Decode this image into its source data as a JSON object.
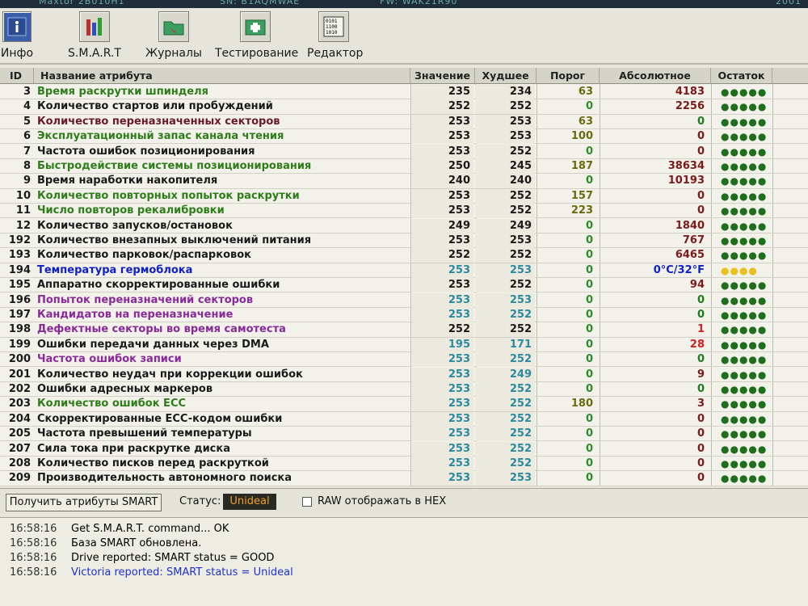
{
  "top_strip": {
    "model": "Maxtor 2B010H1",
    "serial": "SN: B1AQMWAE",
    "firmware": "FW: WAK21R90",
    "right": "2001"
  },
  "toolbar": [
    {
      "name": "info",
      "label": "Инфо"
    },
    {
      "name": "smart",
      "label": "S.M.A.R.T"
    },
    {
      "name": "journals",
      "label": "Журналы"
    },
    {
      "name": "testing",
      "label": "Тестирование"
    },
    {
      "name": "editor",
      "label": "Редактор"
    }
  ],
  "table": {
    "headers": {
      "id": "ID",
      "name": "Название атрибута",
      "value": "Значение",
      "worst": "Худшее",
      "threshold": "Порог",
      "raw": "Абсолютное",
      "remaining": "Остаток"
    },
    "rows": [
      {
        "id": "3",
        "name": "Время раскрутки шпинделя",
        "value": "235",
        "worst": "234",
        "threshold": "63",
        "raw": "4183",
        "rem": "●●●●●"
      },
      {
        "id": "4",
        "name": "Количество стартов или пробуждений",
        "value": "252",
        "worst": "252",
        "threshold": "0",
        "raw": "2256",
        "rem": "●●●●●"
      },
      {
        "id": "5",
        "name": "Количество переназначенных секторов",
        "value": "253",
        "worst": "253",
        "threshold": "63",
        "raw": "0",
        "rem": "●●●●●"
      },
      {
        "id": "6",
        "name": "Эксплуатационный запас канала чтения",
        "value": "253",
        "worst": "253",
        "threshold": "100",
        "raw": "0",
        "rem": "●●●●●"
      },
      {
        "id": "7",
        "name": "Частота ошибок позиционирования",
        "value": "253",
        "worst": "252",
        "threshold": "0",
        "raw": "0",
        "rem": "●●●●●"
      },
      {
        "id": "8",
        "name": "Быстродействие системы позиционирования",
        "value": "250",
        "worst": "245",
        "threshold": "187",
        "raw": "38634",
        "rem": "●●●●●"
      },
      {
        "id": "9",
        "name": "Время наработки накопителя",
        "value": "240",
        "worst": "240",
        "threshold": "0",
        "raw": "10193",
        "rem": "●●●●●"
      },
      {
        "id": "10",
        "name": "Количество повторных попыток раскрутки",
        "value": "253",
        "worst": "252",
        "threshold": "157",
        "raw": "0",
        "rem": "●●●●●"
      },
      {
        "id": "11",
        "name": "Число повторов рекалибровки",
        "value": "253",
        "worst": "252",
        "threshold": "223",
        "raw": "0",
        "rem": "●●●●●"
      },
      {
        "id": "12",
        "name": "Количество запусков/остановок",
        "value": "249",
        "worst": "249",
        "threshold": "0",
        "raw": "1840",
        "rem": "●●●●●"
      },
      {
        "id": "192",
        "name": "Количество внезапных выключений питания",
        "value": "253",
        "worst": "253",
        "threshold": "0",
        "raw": "767",
        "rem": "●●●●●"
      },
      {
        "id": "193",
        "name": "Количество парковок/распарковок",
        "value": "252",
        "worst": "252",
        "threshold": "0",
        "raw": "6465",
        "rem": "●●●●●"
      },
      {
        "id": "194",
        "name": "Температура гермоблока",
        "value": "253",
        "worst": "253",
        "threshold": "0",
        "raw": "0°C/32°F",
        "rem": "●●●●"
      },
      {
        "id": "195",
        "name": "Аппаратно скорректированные ошибки",
        "value": "253",
        "worst": "252",
        "threshold": "0",
        "raw": "94",
        "rem": "●●●●●"
      },
      {
        "id": "196",
        "name": "Попыток переназначений секторов",
        "value": "253",
        "worst": "253",
        "threshold": "0",
        "raw": "0",
        "rem": "●●●●●"
      },
      {
        "id": "197",
        "name": "Кандидатов на переназначение",
        "value": "253",
        "worst": "252",
        "threshold": "0",
        "raw": "0",
        "rem": "●●●●●"
      },
      {
        "id": "198",
        "name": "Дефектные секторы во время самотеста",
        "value": "252",
        "worst": "252",
        "threshold": "0",
        "raw": "1",
        "rem": "●●●●●"
      },
      {
        "id": "199",
        "name": "Ошибки передачи данных через DMA",
        "value": "195",
        "worst": "171",
        "threshold": "0",
        "raw": "28",
        "rem": "●●●●●"
      },
      {
        "id": "200",
        "name": "Частота ошибок записи",
        "value": "253",
        "worst": "252",
        "threshold": "0",
        "raw": "0",
        "rem": "●●●●●"
      },
      {
        "id": "201",
        "name": "Количество неудач при коррекции ошибок",
        "value": "253",
        "worst": "249",
        "threshold": "0",
        "raw": "9",
        "rem": "●●●●●"
      },
      {
        "id": "202",
        "name": "Ошибки адресных маркеров",
        "value": "253",
        "worst": "252",
        "threshold": "0",
        "raw": "0",
        "rem": "●●●●●"
      },
      {
        "id": "203",
        "name": "Количество ошибок ECC",
        "value": "253",
        "worst": "252",
        "threshold": "180",
        "raw": "3",
        "rem": "●●●●●"
      },
      {
        "id": "204",
        "name": "Скорректированные ECC-кодом ошибки",
        "value": "253",
        "worst": "252",
        "threshold": "0",
        "raw": "0",
        "rem": "●●●●●"
      },
      {
        "id": "205",
        "name": "Частота превышений температуры",
        "value": "253",
        "worst": "252",
        "threshold": "0",
        "raw": "0",
        "rem": "●●●●●"
      },
      {
        "id": "207",
        "name": "Сила тока при раскрутке диска",
        "value": "253",
        "worst": "252",
        "threshold": "0",
        "raw": "0",
        "rem": "●●●●●"
      },
      {
        "id": "208",
        "name": "Количество писков перед раскруткой",
        "value": "253",
        "worst": "252",
        "threshold": "0",
        "raw": "0",
        "rem": "●●●●●"
      },
      {
        "id": "209",
        "name": "Производительность автономного поиска",
        "value": "253",
        "worst": "253",
        "threshold": "0",
        "raw": "0",
        "rem": "●●●●●"
      }
    ]
  },
  "colors": {
    "name_green": "#2e7d1a",
    "name_dark": "#1a1a1a",
    "name_maroon": "#6a1830",
    "name_purple": "#8a2a9a",
    "name_blue": "#1020c8",
    "val_dark": "#1a1a1a",
    "val_teal": "#2a8aa0",
    "thr_olive": "#6a6a10",
    "thr_green": "#2e8a2e",
    "raw_maroon": "#7a1a1a",
    "raw_green": "#1e7a1e",
    "raw_red": "#d02020",
    "raw_blue": "#1020c8",
    "dots_green": "#1e6e1e",
    "dots_yellow": "#e8c020",
    "log_blue": "#2030d0"
  },
  "controls": {
    "get_button": "Получить атрибуты SMART",
    "status_label": "Статус:",
    "status_value": "Unideal",
    "raw_hex_label": "RAW отображать в HEX"
  },
  "log": [
    {
      "time": "16:58:16",
      "text": "Get S.M.A.R.T. command... OK",
      "color": "#333333"
    },
    {
      "time": "16:58:16",
      "text": "База SMART обновлена.",
      "color": "#333333"
    },
    {
      "time": "16:58:16",
      "text": "Drive reported: SMART status = GOOD",
      "color": "#333333"
    },
    {
      "time": "16:58:16",
      "text": "Victoria reported: SMART status = Unideal",
      "color": "#2030d0"
    }
  ]
}
